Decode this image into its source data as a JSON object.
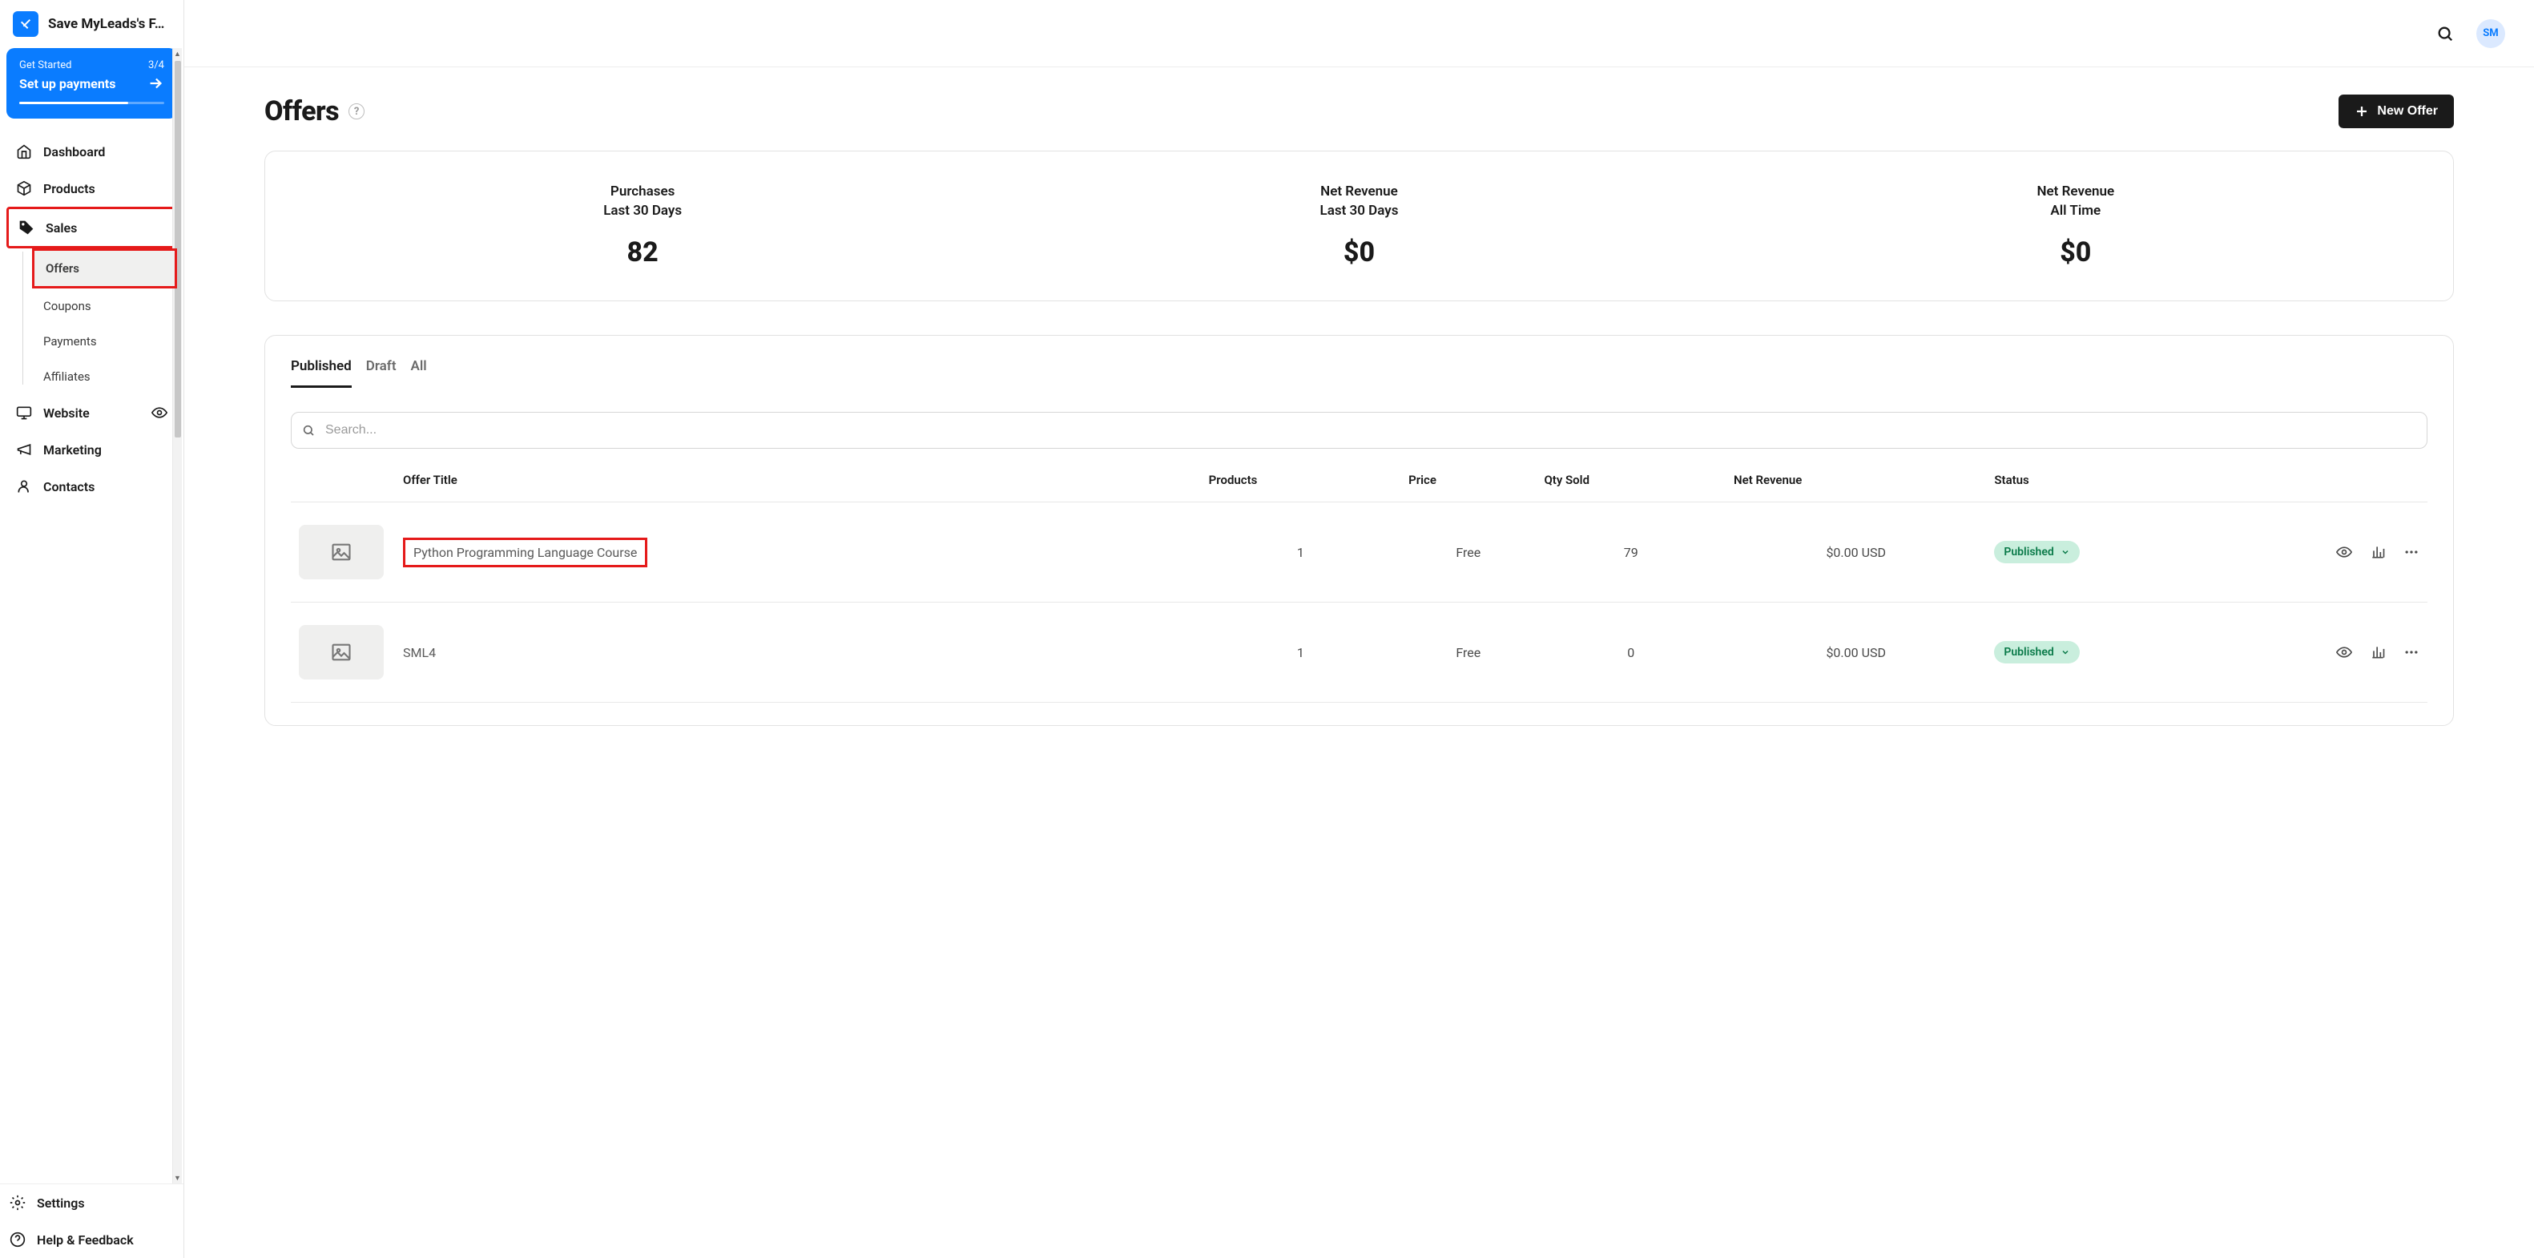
{
  "sidebar": {
    "title": "Save MyLeads's F…",
    "get_started": {
      "label": "Get Started",
      "progress": "3/4",
      "action": "Set up payments"
    },
    "items": {
      "dashboard": "Dashboard",
      "products": "Products",
      "sales": "Sales",
      "website": "Website",
      "marketing": "Marketing",
      "contacts": "Contacts",
      "settings": "Settings",
      "help": "Help & Feedback"
    },
    "sales_sub": {
      "offers": "Offers",
      "coupons": "Coupons",
      "payments": "Payments",
      "affiliates": "Affiliates"
    }
  },
  "topbar": {
    "avatar": "SM"
  },
  "page": {
    "title": "Offers",
    "new_button": "New Offer"
  },
  "stats": {
    "purchases": {
      "label": "Purchases",
      "sub": "Last 30 Days",
      "value": "82"
    },
    "revenue30": {
      "label": "Net Revenue",
      "sub": "Last 30 Days",
      "value": "$0"
    },
    "revenueAll": {
      "label": "Net Revenue",
      "sub": "All Time",
      "value": "$0"
    }
  },
  "tabs": {
    "published": "Published",
    "draft": "Draft",
    "all": "All"
  },
  "search": {
    "placeholder": "Search..."
  },
  "columns": {
    "title": "Offer Title",
    "products": "Products",
    "price": "Price",
    "qty": "Qty Sold",
    "revenue": "Net Revenue",
    "status": "Status"
  },
  "rows": [
    {
      "title": "Python Programming Language Course",
      "products": "1",
      "price": "Free",
      "qty": "79",
      "revenue": "$0.00 USD",
      "status": "Published"
    },
    {
      "title": "SML4",
      "products": "1",
      "price": "Free",
      "qty": "0",
      "revenue": "$0.00 USD",
      "status": "Published"
    }
  ]
}
